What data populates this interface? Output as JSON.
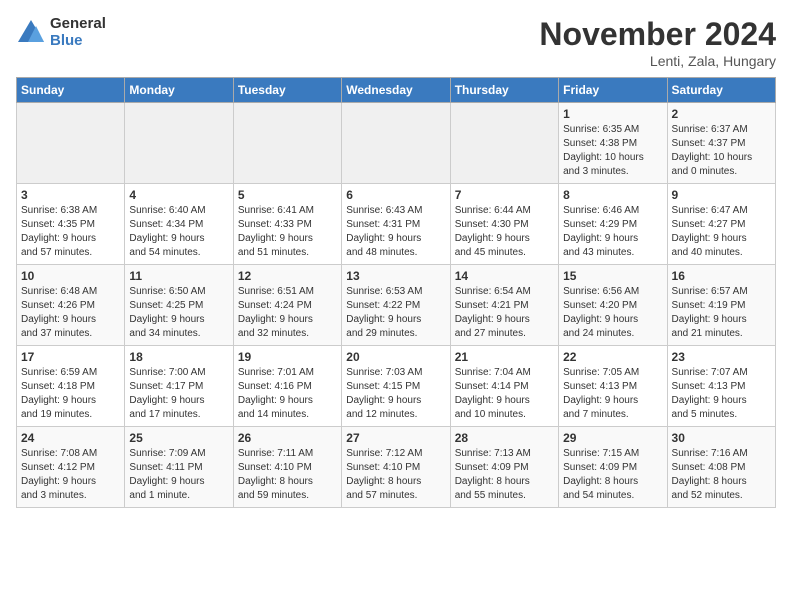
{
  "logo": {
    "general": "General",
    "blue": "Blue"
  },
  "title": "November 2024",
  "location": "Lenti, Zala, Hungary",
  "days_header": [
    "Sunday",
    "Monday",
    "Tuesday",
    "Wednesday",
    "Thursday",
    "Friday",
    "Saturday"
  ],
  "weeks": [
    [
      {
        "day": "",
        "detail": ""
      },
      {
        "day": "",
        "detail": ""
      },
      {
        "day": "",
        "detail": ""
      },
      {
        "day": "",
        "detail": ""
      },
      {
        "day": "",
        "detail": ""
      },
      {
        "day": "1",
        "detail": "Sunrise: 6:35 AM\nSunset: 4:38 PM\nDaylight: 10 hours\nand 3 minutes."
      },
      {
        "day": "2",
        "detail": "Sunrise: 6:37 AM\nSunset: 4:37 PM\nDaylight: 10 hours\nand 0 minutes."
      }
    ],
    [
      {
        "day": "3",
        "detail": "Sunrise: 6:38 AM\nSunset: 4:35 PM\nDaylight: 9 hours\nand 57 minutes."
      },
      {
        "day": "4",
        "detail": "Sunrise: 6:40 AM\nSunset: 4:34 PM\nDaylight: 9 hours\nand 54 minutes."
      },
      {
        "day": "5",
        "detail": "Sunrise: 6:41 AM\nSunset: 4:33 PM\nDaylight: 9 hours\nand 51 minutes."
      },
      {
        "day": "6",
        "detail": "Sunrise: 6:43 AM\nSunset: 4:31 PM\nDaylight: 9 hours\nand 48 minutes."
      },
      {
        "day": "7",
        "detail": "Sunrise: 6:44 AM\nSunset: 4:30 PM\nDaylight: 9 hours\nand 45 minutes."
      },
      {
        "day": "8",
        "detail": "Sunrise: 6:46 AM\nSunset: 4:29 PM\nDaylight: 9 hours\nand 43 minutes."
      },
      {
        "day": "9",
        "detail": "Sunrise: 6:47 AM\nSunset: 4:27 PM\nDaylight: 9 hours\nand 40 minutes."
      }
    ],
    [
      {
        "day": "10",
        "detail": "Sunrise: 6:48 AM\nSunset: 4:26 PM\nDaylight: 9 hours\nand 37 minutes."
      },
      {
        "day": "11",
        "detail": "Sunrise: 6:50 AM\nSunset: 4:25 PM\nDaylight: 9 hours\nand 34 minutes."
      },
      {
        "day": "12",
        "detail": "Sunrise: 6:51 AM\nSunset: 4:24 PM\nDaylight: 9 hours\nand 32 minutes."
      },
      {
        "day": "13",
        "detail": "Sunrise: 6:53 AM\nSunset: 4:22 PM\nDaylight: 9 hours\nand 29 minutes."
      },
      {
        "day": "14",
        "detail": "Sunrise: 6:54 AM\nSunset: 4:21 PM\nDaylight: 9 hours\nand 27 minutes."
      },
      {
        "day": "15",
        "detail": "Sunrise: 6:56 AM\nSunset: 4:20 PM\nDaylight: 9 hours\nand 24 minutes."
      },
      {
        "day": "16",
        "detail": "Sunrise: 6:57 AM\nSunset: 4:19 PM\nDaylight: 9 hours\nand 21 minutes."
      }
    ],
    [
      {
        "day": "17",
        "detail": "Sunrise: 6:59 AM\nSunset: 4:18 PM\nDaylight: 9 hours\nand 19 minutes."
      },
      {
        "day": "18",
        "detail": "Sunrise: 7:00 AM\nSunset: 4:17 PM\nDaylight: 9 hours\nand 17 minutes."
      },
      {
        "day": "19",
        "detail": "Sunrise: 7:01 AM\nSunset: 4:16 PM\nDaylight: 9 hours\nand 14 minutes."
      },
      {
        "day": "20",
        "detail": "Sunrise: 7:03 AM\nSunset: 4:15 PM\nDaylight: 9 hours\nand 12 minutes."
      },
      {
        "day": "21",
        "detail": "Sunrise: 7:04 AM\nSunset: 4:14 PM\nDaylight: 9 hours\nand 10 minutes."
      },
      {
        "day": "22",
        "detail": "Sunrise: 7:05 AM\nSunset: 4:13 PM\nDaylight: 9 hours\nand 7 minutes."
      },
      {
        "day": "23",
        "detail": "Sunrise: 7:07 AM\nSunset: 4:13 PM\nDaylight: 9 hours\nand 5 minutes."
      }
    ],
    [
      {
        "day": "24",
        "detail": "Sunrise: 7:08 AM\nSunset: 4:12 PM\nDaylight: 9 hours\nand 3 minutes."
      },
      {
        "day": "25",
        "detail": "Sunrise: 7:09 AM\nSunset: 4:11 PM\nDaylight: 9 hours\nand 1 minute."
      },
      {
        "day": "26",
        "detail": "Sunrise: 7:11 AM\nSunset: 4:10 PM\nDaylight: 8 hours\nand 59 minutes."
      },
      {
        "day": "27",
        "detail": "Sunrise: 7:12 AM\nSunset: 4:10 PM\nDaylight: 8 hours\nand 57 minutes."
      },
      {
        "day": "28",
        "detail": "Sunrise: 7:13 AM\nSunset: 4:09 PM\nDaylight: 8 hours\nand 55 minutes."
      },
      {
        "day": "29",
        "detail": "Sunrise: 7:15 AM\nSunset: 4:09 PM\nDaylight: 8 hours\nand 54 minutes."
      },
      {
        "day": "30",
        "detail": "Sunrise: 7:16 AM\nSunset: 4:08 PM\nDaylight: 8 hours\nand 52 minutes."
      }
    ]
  ]
}
